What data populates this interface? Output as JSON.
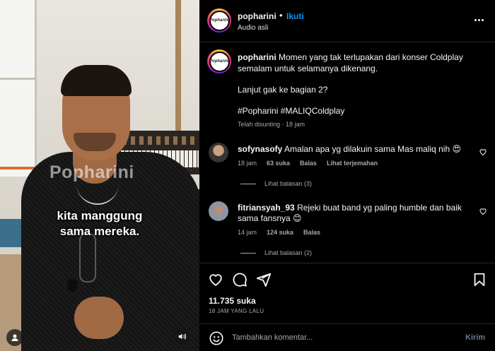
{
  "video": {
    "watermark": "Popharini",
    "caption_line1": "kita manggung",
    "caption_line2": "sama mereka."
  },
  "header": {
    "username": "popharini",
    "separator": "•",
    "follow_label": "Ikuti",
    "audio_label": "Audio asli",
    "avatar_text": "Popharini"
  },
  "post_caption": {
    "username": "popharini",
    "text": "Momen yang tak terlupakan dari konser Coldplay semalam untuk selamanya dikenang.",
    "line2": "Lanjut gak ke bagian 2?",
    "hashtags": "#Popharini #MALIQColdplay",
    "meta": "Telah disunting · 18 jam"
  },
  "comments": [
    {
      "username": "sofynasofy",
      "text": "Amalan apa yg dilakuin sama Mas maliq nih 😍",
      "time": "18 jam",
      "likes": "63 suka",
      "reply_label": "Balas",
      "translate_label": "Lihat terjemahan",
      "view_replies": "Lihat balasan (3)"
    },
    {
      "username": "fitriansyah_93",
      "text": "Rejeki buat band yg paling humble dan baik sama fansnya 😊",
      "time": "14 jam",
      "likes": "124 suka",
      "reply_label": "Balas",
      "view_replies": "Lihat balasan (2)"
    }
  ],
  "actions": {
    "likes": "11.735 suka",
    "time_ago": "18 JAM YANG LALU",
    "comment_placeholder": "Tambahkan komentar...",
    "send_label": "Kirim"
  },
  "icons": {
    "like": "heart-icon",
    "comment": "comment-icon",
    "share": "send-icon",
    "save": "bookmark-icon",
    "more": "more-horizontal-icon",
    "emoji": "emoji-icon",
    "mute": "volume-icon",
    "tagged_user": "user-icon"
  },
  "colors": {
    "background": "#000000",
    "accent": "#0095f6",
    "secondary_text": "#a8a8a8",
    "divider": "#262626"
  }
}
